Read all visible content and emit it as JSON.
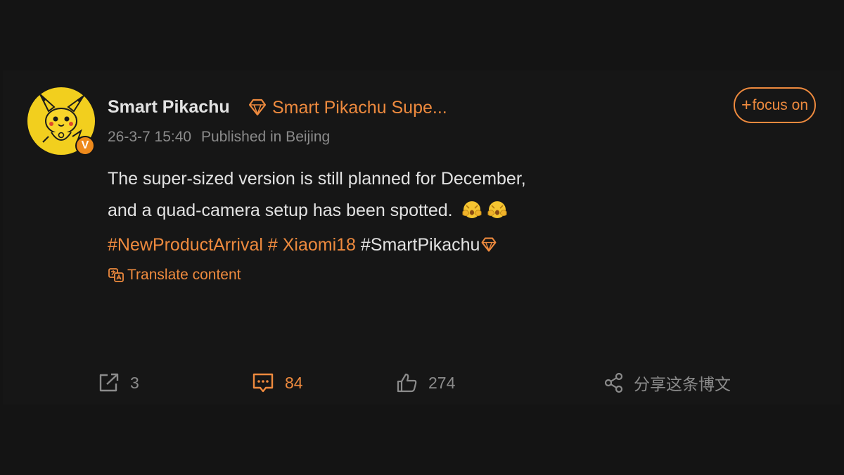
{
  "post": {
    "author": "Smart Pikachu",
    "supertopic": "Smart Pikachu Supe...",
    "date": "26-3-7 15:40",
    "location": "Published in Beijing",
    "follow_label": "focus on",
    "verified_badge": "V",
    "text_line1": "The super-sized version is still planned for December,",
    "text_line2": "and a quad-camera setup has been spotted.",
    "hashtags": {
      "tag1": "#NewProductArrival",
      "tag2": "# Xiaomi18",
      "tag3": "#SmartPikachu"
    },
    "translate_label": "Translate content"
  },
  "actions": {
    "repost_count": "3",
    "comment_count": "84",
    "like_count": "274",
    "share_label": "分享这条博文"
  },
  "icons": {
    "avatar": "pikachu-avatar-icon",
    "gem": "diamond-gem-icon",
    "emoji": "peeking-face-emoji-icon",
    "translate": "translate-icon",
    "repost": "repost-icon",
    "comment": "comment-icon",
    "like": "thumbs-up-icon",
    "share": "share-icon"
  },
  "colors": {
    "background": "#141414",
    "accent": "#ee8a3e",
    "text": "#e2e2e2",
    "muted": "#8b8b8b",
    "avatar_bg": "#f2cf1e"
  }
}
